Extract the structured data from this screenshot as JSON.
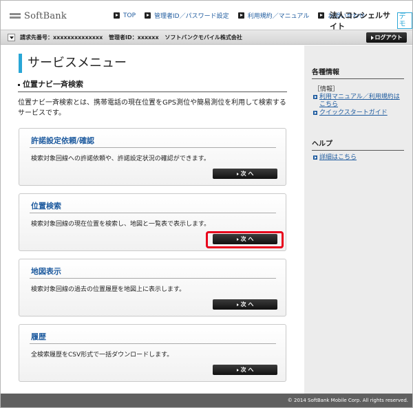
{
  "header": {
    "logo": "SoftBank",
    "nav": [
      {
        "label": "TOP"
      },
      {
        "label": "管理者ID／パスワード設定"
      },
      {
        "label": "利用規約／マニュアル"
      },
      {
        "label": "お問い合わせ"
      }
    ],
    "site_title": "法人コンシェルサイト",
    "demo_badge": "デモ"
  },
  "infobar": {
    "billing": "請求先番号：xxxxxxxxxxxxxx",
    "admin": "管理者ID：xxxxxx",
    "company": "ソフトバンクモバイル株式会社",
    "logout_label": "ログアウト"
  },
  "main": {
    "page_title": "サービスメニュー",
    "section_title": "位置ナビ一斉検索",
    "description": "位置ナビ一斉検索とは、携帯電話の現在位置をGPS測位や簡易測位を利用して検索するサービスです。",
    "cards": [
      {
        "title": "許諾設定依頼/確認",
        "desc": "検索対象回線への許諾依頼や、許諾設定状況の確認ができます。",
        "button": "次 へ"
      },
      {
        "title": "位置検索",
        "desc": "検索対象回線の現在位置を検索し、地図と一覧表で表示します。",
        "button": "次 へ"
      },
      {
        "title": "地図表示",
        "desc": "検索対象回線の過去の位置履歴を地図上に表示します。",
        "button": "次 へ"
      },
      {
        "title": "履歴",
        "desc": "全検索履歴をCSV形式で一括ダウンロードします。",
        "button": "次 へ"
      }
    ]
  },
  "sidebar": {
    "info_heading": "各種情報",
    "info_small": "［情報］",
    "info_links": [
      {
        "label": "利用マニュアル／利用規約は"
      },
      {
        "label": "こちら"
      },
      {
        "label": "クイックスタートガイド"
      }
    ],
    "help_heading": "ヘルプ",
    "help_link": "詳細はこちら"
  },
  "footer": {
    "copyright": "© 2014 SoftBank Mobile Corp. All rights reserved."
  },
  "colors": {
    "accent": "#29a6d6",
    "link": "#1d5a9e",
    "highlight": "#e8001c"
  }
}
